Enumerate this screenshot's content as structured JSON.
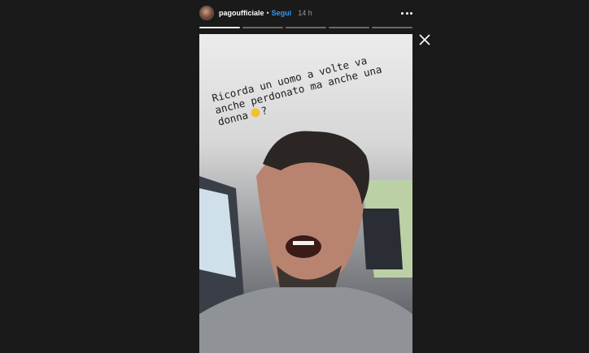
{
  "header": {
    "username": "pagoufficiale",
    "separator": "•",
    "follow_label": "Segui",
    "time": "14 h"
  },
  "progress": {
    "segments": 5,
    "active_index": 0
  },
  "story": {
    "caption_lines": [
      "Ricorda un uomo a volte va",
      "anche perdonato ma anche una",
      "donna"
    ],
    "caption_suffix": "?",
    "emoji": "thinking-face-emoji"
  },
  "icons": {
    "more": "more-options-icon",
    "close": "close-icon"
  },
  "colors": {
    "background": "#1a1a1a",
    "follow": "#3897f0"
  }
}
